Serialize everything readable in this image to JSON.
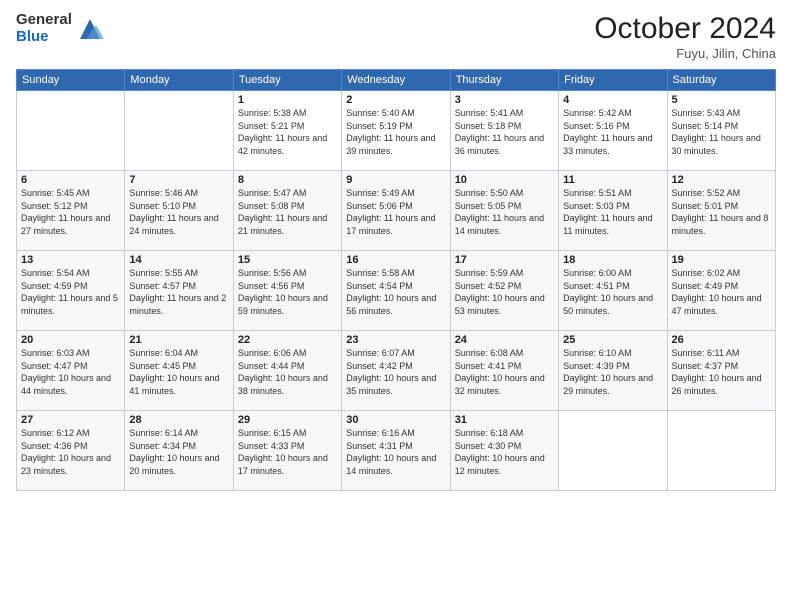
{
  "header": {
    "logo_general": "General",
    "logo_blue": "Blue",
    "month_title": "October 2024",
    "location": "Fuyu, Jilin, China"
  },
  "weekdays": [
    "Sunday",
    "Monday",
    "Tuesday",
    "Wednesday",
    "Thursday",
    "Friday",
    "Saturday"
  ],
  "weeks": [
    [
      {
        "day": "",
        "info": ""
      },
      {
        "day": "",
        "info": ""
      },
      {
        "day": "1",
        "info": "Sunrise: 5:38 AM\nSunset: 5:21 PM\nDaylight: 11 hours and 42 minutes."
      },
      {
        "day": "2",
        "info": "Sunrise: 5:40 AM\nSunset: 5:19 PM\nDaylight: 11 hours and 39 minutes."
      },
      {
        "day": "3",
        "info": "Sunrise: 5:41 AM\nSunset: 5:18 PM\nDaylight: 11 hours and 36 minutes."
      },
      {
        "day": "4",
        "info": "Sunrise: 5:42 AM\nSunset: 5:16 PM\nDaylight: 11 hours and 33 minutes."
      },
      {
        "day": "5",
        "info": "Sunrise: 5:43 AM\nSunset: 5:14 PM\nDaylight: 11 hours and 30 minutes."
      }
    ],
    [
      {
        "day": "6",
        "info": "Sunrise: 5:45 AM\nSunset: 5:12 PM\nDaylight: 11 hours and 27 minutes."
      },
      {
        "day": "7",
        "info": "Sunrise: 5:46 AM\nSunset: 5:10 PM\nDaylight: 11 hours and 24 minutes."
      },
      {
        "day": "8",
        "info": "Sunrise: 5:47 AM\nSunset: 5:08 PM\nDaylight: 11 hours and 21 minutes."
      },
      {
        "day": "9",
        "info": "Sunrise: 5:49 AM\nSunset: 5:06 PM\nDaylight: 11 hours and 17 minutes."
      },
      {
        "day": "10",
        "info": "Sunrise: 5:50 AM\nSunset: 5:05 PM\nDaylight: 11 hours and 14 minutes."
      },
      {
        "day": "11",
        "info": "Sunrise: 5:51 AM\nSunset: 5:03 PM\nDaylight: 11 hours and 11 minutes."
      },
      {
        "day": "12",
        "info": "Sunrise: 5:52 AM\nSunset: 5:01 PM\nDaylight: 11 hours and 8 minutes."
      }
    ],
    [
      {
        "day": "13",
        "info": "Sunrise: 5:54 AM\nSunset: 4:59 PM\nDaylight: 11 hours and 5 minutes."
      },
      {
        "day": "14",
        "info": "Sunrise: 5:55 AM\nSunset: 4:57 PM\nDaylight: 11 hours and 2 minutes."
      },
      {
        "day": "15",
        "info": "Sunrise: 5:56 AM\nSunset: 4:56 PM\nDaylight: 10 hours and 59 minutes."
      },
      {
        "day": "16",
        "info": "Sunrise: 5:58 AM\nSunset: 4:54 PM\nDaylight: 10 hours and 56 minutes."
      },
      {
        "day": "17",
        "info": "Sunrise: 5:59 AM\nSunset: 4:52 PM\nDaylight: 10 hours and 53 minutes."
      },
      {
        "day": "18",
        "info": "Sunrise: 6:00 AM\nSunset: 4:51 PM\nDaylight: 10 hours and 50 minutes."
      },
      {
        "day": "19",
        "info": "Sunrise: 6:02 AM\nSunset: 4:49 PM\nDaylight: 10 hours and 47 minutes."
      }
    ],
    [
      {
        "day": "20",
        "info": "Sunrise: 6:03 AM\nSunset: 4:47 PM\nDaylight: 10 hours and 44 minutes."
      },
      {
        "day": "21",
        "info": "Sunrise: 6:04 AM\nSunset: 4:45 PM\nDaylight: 10 hours and 41 minutes."
      },
      {
        "day": "22",
        "info": "Sunrise: 6:06 AM\nSunset: 4:44 PM\nDaylight: 10 hours and 38 minutes."
      },
      {
        "day": "23",
        "info": "Sunrise: 6:07 AM\nSunset: 4:42 PM\nDaylight: 10 hours and 35 minutes."
      },
      {
        "day": "24",
        "info": "Sunrise: 6:08 AM\nSunset: 4:41 PM\nDaylight: 10 hours and 32 minutes."
      },
      {
        "day": "25",
        "info": "Sunrise: 6:10 AM\nSunset: 4:39 PM\nDaylight: 10 hours and 29 minutes."
      },
      {
        "day": "26",
        "info": "Sunrise: 6:11 AM\nSunset: 4:37 PM\nDaylight: 10 hours and 26 minutes."
      }
    ],
    [
      {
        "day": "27",
        "info": "Sunrise: 6:12 AM\nSunset: 4:36 PM\nDaylight: 10 hours and 23 minutes."
      },
      {
        "day": "28",
        "info": "Sunrise: 6:14 AM\nSunset: 4:34 PM\nDaylight: 10 hours and 20 minutes."
      },
      {
        "day": "29",
        "info": "Sunrise: 6:15 AM\nSunset: 4:33 PM\nDaylight: 10 hours and 17 minutes."
      },
      {
        "day": "30",
        "info": "Sunrise: 6:16 AM\nSunset: 4:31 PM\nDaylight: 10 hours and 14 minutes."
      },
      {
        "day": "31",
        "info": "Sunrise: 6:18 AM\nSunset: 4:30 PM\nDaylight: 10 hours and 12 minutes."
      },
      {
        "day": "",
        "info": ""
      },
      {
        "day": "",
        "info": ""
      }
    ]
  ]
}
